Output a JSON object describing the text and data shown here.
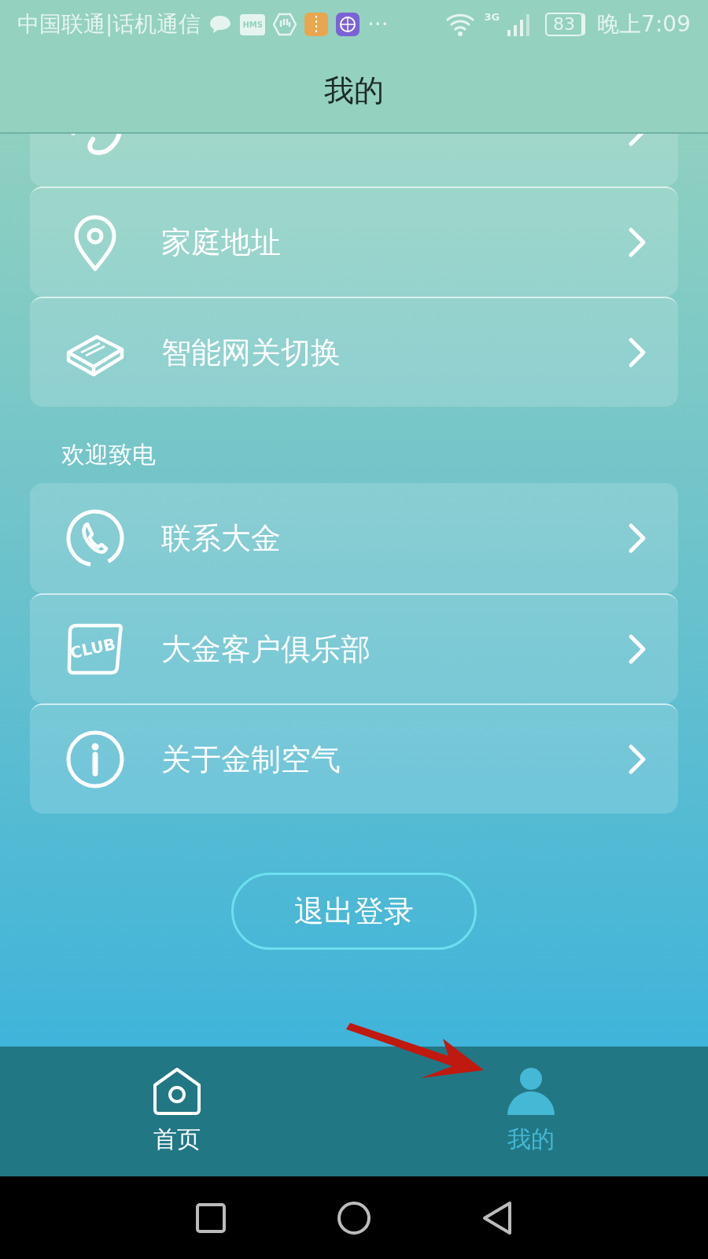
{
  "status_bar": {
    "carrier": "中国联通|话机通信",
    "notifications": [
      {
        "kind": "chat"
      },
      {
        "kind": "hms",
        "label": "HMS"
      },
      {
        "kind": "hand"
      },
      {
        "kind": "box"
      },
      {
        "kind": "browser"
      }
    ],
    "more": "···",
    "network": "3G",
    "battery": "83",
    "time": "晚上7:09"
  },
  "header": {
    "title": "我的"
  },
  "groups": [
    {
      "items": [
        {
          "kind": "phone-link"
        },
        {
          "kind": "pin",
          "label": "家庭地址"
        },
        {
          "kind": "gateway",
          "label": "智能网关切换"
        }
      ]
    },
    {
      "title": "欢迎致电",
      "items": [
        {
          "kind": "phone",
          "label": "联系大金"
        },
        {
          "kind": "club",
          "label": "大金客户俱乐部",
          "badge_text": "CLUB"
        },
        {
          "kind": "info",
          "label": "关于金制空气"
        }
      ]
    }
  ],
  "logout": {
    "label": "退出登录"
  },
  "tab_bar": [
    {
      "kind": "home",
      "label": "首页",
      "selected": false
    },
    {
      "kind": "person",
      "label": "我的",
      "selected": true
    }
  ]
}
